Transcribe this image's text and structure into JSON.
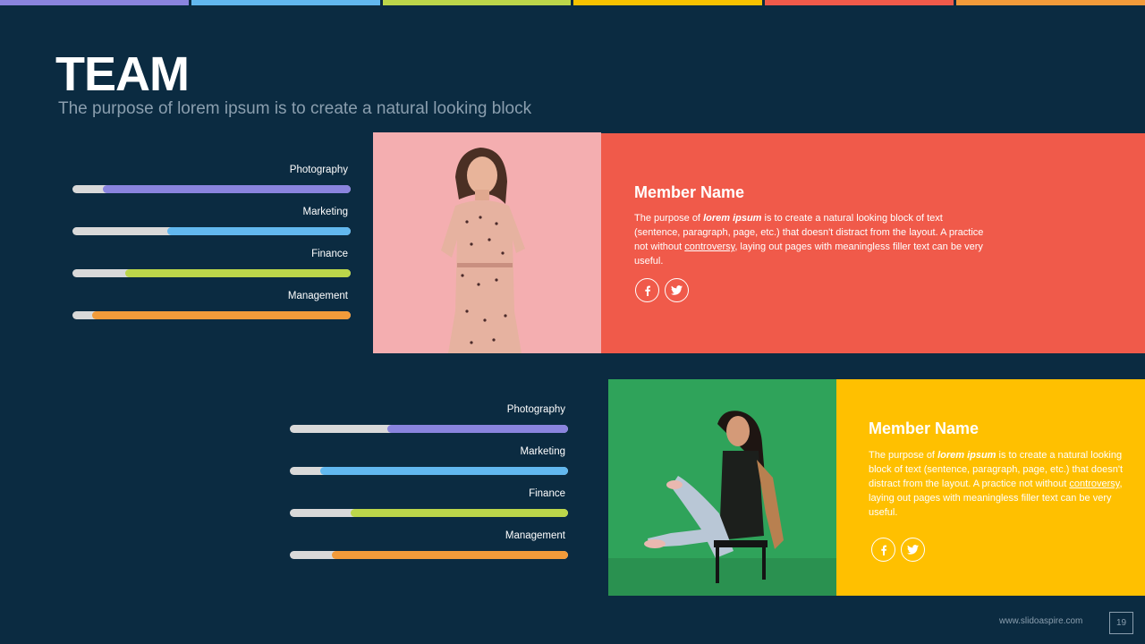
{
  "colors": {
    "background": "#0b2b41",
    "purple": "#8a84de",
    "blue": "#62b8ef",
    "green": "#bcd64a",
    "yellow": "#f7c200",
    "red": "#f05a4a",
    "orange": "#f29b3a",
    "track": "#d9d9d9"
  },
  "top_bar": [
    "#8a84de",
    "#62b8ef",
    "#bcd64a",
    "#f7c200",
    "#f05a4a",
    "#f29b3a"
  ],
  "header": {
    "title": "TEAM",
    "subtitle": "The purpose of lorem ipsum is to create a natural looking block"
  },
  "members": [
    {
      "name": "Member Name",
      "text_pre": "The purpose of ",
      "text_em": "lorem ipsum",
      "text_mid": " is to create a natural looking block of text (sentence, paragraph, page, etc.) that doesn't distract from the layout. A practice not without ",
      "text_link": "controversy",
      "text_post": ", laying out pages with meaningless filler text can be very useful.",
      "card_color": "#f05a4a",
      "photo_bg": "#f4aeb0",
      "skills": [
        {
          "label": "Photography",
          "level": 0.89,
          "color": "#8a84de"
        },
        {
          "label": "Marketing",
          "level": 0.66,
          "color": "#62b8ef"
        },
        {
          "label": "Finance",
          "level": 0.81,
          "color": "#bcd64a"
        },
        {
          "label": "Management",
          "level": 0.93,
          "color": "#f29b3a"
        }
      ]
    },
    {
      "name": "Member Name",
      "text_pre": "The purpose of ",
      "text_em": "lorem ipsum",
      "text_mid": " is to create a natural looking block of text (sentence, paragraph, page, etc.) that doesn't distract from the layout. A practice not without ",
      "text_link": "controversy",
      "text_post": ", laying out pages with meaningless filler text can be very useful.",
      "card_color": "#ffc000",
      "photo_bg": "#2fa35a",
      "skills": [
        {
          "label": "Photography",
          "level": 0.65,
          "color": "#8a84de"
        },
        {
          "label": "Marketing",
          "level": 0.89,
          "color": "#62b8ef"
        },
        {
          "label": "Finance",
          "level": 0.78,
          "color": "#bcd64a"
        },
        {
          "label": "Management",
          "level": 0.85,
          "color": "#f29b3a"
        }
      ]
    }
  ],
  "social_icons": [
    "facebook-icon",
    "twitter-icon"
  ],
  "footer": {
    "url": "www.slidoaspire.com",
    "page": "19"
  }
}
